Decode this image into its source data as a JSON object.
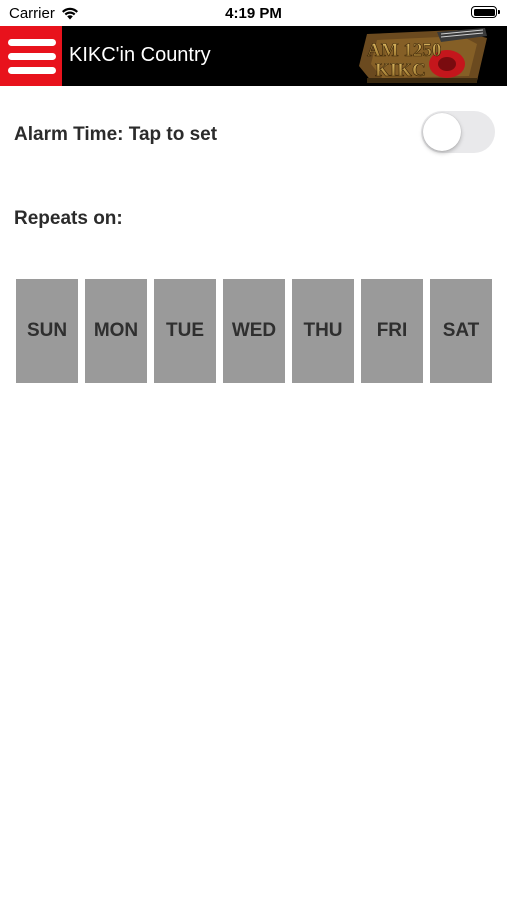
{
  "status_bar": {
    "carrier": "Carrier",
    "time": "4:19 PM"
  },
  "nav": {
    "title": "KIKC'in Country",
    "menu_icon": "hamburger-menu-icon",
    "accent_color": "#e8121c",
    "logo": {
      "line1": "AM 1250",
      "line2": "KIKC"
    }
  },
  "alarm": {
    "label": "Alarm Time: Tap to set",
    "toggle_on": false
  },
  "repeats": {
    "label": "Repeats on:",
    "days": [
      "SUN",
      "MON",
      "TUE",
      "WED",
      "THU",
      "FRI",
      "SAT"
    ]
  }
}
